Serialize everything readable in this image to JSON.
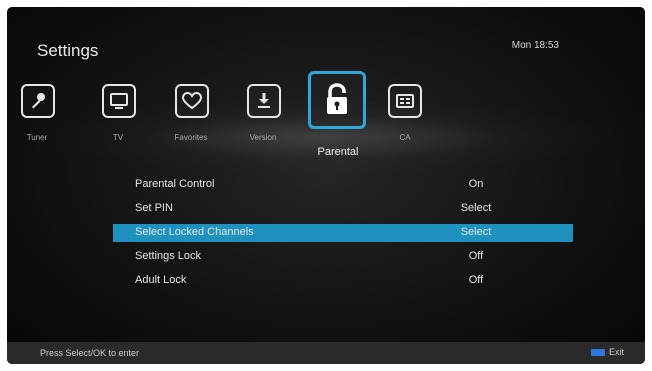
{
  "header": {
    "title": "Settings",
    "clock": "Mon 18:53"
  },
  "nav": {
    "items": [
      {
        "label": "Tuner",
        "icon": "microphone-icon"
      },
      {
        "label": "TV",
        "icon": "tv-icon"
      },
      {
        "label": "Favorites",
        "icon": "heart-icon"
      },
      {
        "label": "Version",
        "icon": "download-icon"
      },
      {
        "label": "Parental",
        "icon": "lock-icon",
        "selected": true
      },
      {
        "label": "CA",
        "icon": "card-icon"
      }
    ]
  },
  "settings": {
    "rows": [
      {
        "label": "Parental Control",
        "value": "On"
      },
      {
        "label": "Set PIN",
        "value": "Select"
      },
      {
        "label": "Select Locked Channels",
        "value": "Select",
        "highlighted": true
      },
      {
        "label": "Settings Lock",
        "value": "Off"
      },
      {
        "label": "Adult Lock",
        "value": "Off"
      }
    ]
  },
  "footer": {
    "hint": "Press Select/OK to enter",
    "exit_label": "Exit"
  },
  "colors": {
    "accent": "#1e91be",
    "selection_border": "#2ea7d9",
    "exit_button": "#2d78e0"
  }
}
